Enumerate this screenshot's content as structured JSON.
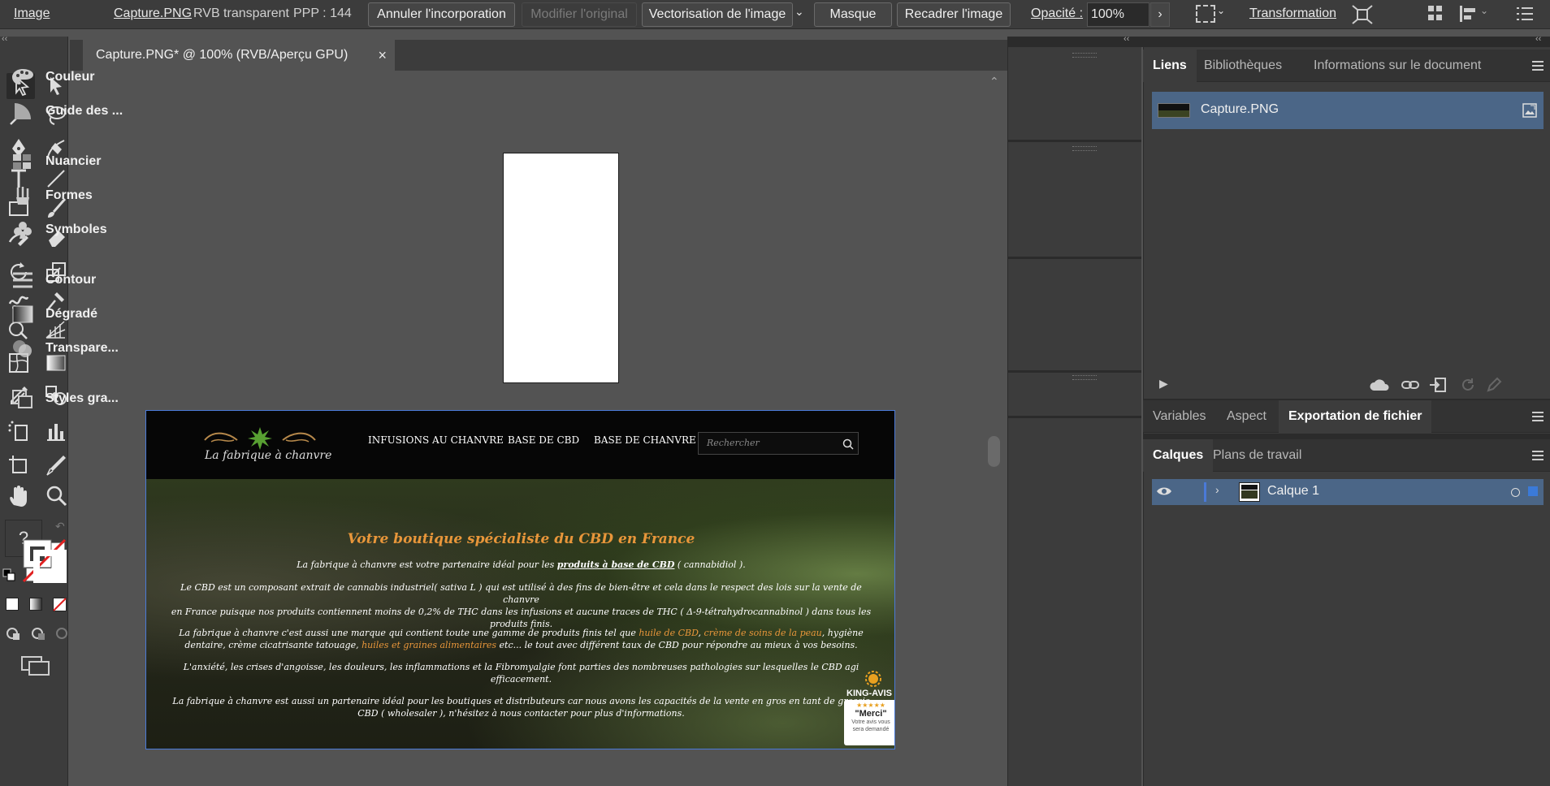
{
  "control_bar": {
    "image_label": "Image",
    "filename": "Capture.PNG",
    "color_mode": "RVB transparent",
    "ppp": "PPP : 144",
    "buttons": {
      "unembed": "Annuler l'incorporation",
      "edit_original": "Modifier l'original",
      "image_trace": "Vectorisation de l'image",
      "mask": "Masque",
      "crop": "Recadrer l'image"
    },
    "opacity_label": "Opacité :",
    "opacity_value": "100%",
    "transform_label": "Transformation"
  },
  "document": {
    "tab_title": "Capture.PNG* @ 100% (RVB/Aperçu GPU)",
    "close_symbol": "×"
  },
  "toolbar": {
    "unknown_tool": "?"
  },
  "placed_image": {
    "logo_text": "La fabrique à chanvre",
    "nav": [
      "INFUSIONS AU CHANVRE",
      "BASE DE CBD",
      "BASE DE CHANVRE"
    ],
    "search_placeholder": "Rechercher",
    "heading": "Votre boutique spécialiste du CBD en France",
    "p1_a": "La fabrique à chanvre est votre partenaire idéal pour les ",
    "p1_link": "produits à base de CBD",
    "p1_b": " ( ",
    "p1_em": "cannabidiol",
    "p1_c": " ).",
    "p2_line1": "Le CBD est un composant extrait de cannabis industriel( sativa L ) qui est utilisé à des fins de bien-être et cela dans le respect des lois sur la vente de chanvre",
    "p2_line2": "en France puisque nos produits contiennent moins de 0,2% de THC dans les infusions et aucune traces de THC ( Δ-9-tétrahydrocannabinol ) dans tous les",
    "p2_line3": "produits finis.",
    "p3_line1_a": "La fabrique à chanvre c'est aussi une marque qui contient toute une gamme de produits finis tel que ",
    "p3_oil": "huile de CBD",
    "p3_sep": ", ",
    "p3_cream": "crème de soins de la peau",
    "p3_line1_b": ", hygiène",
    "p3_line2_a": "dentaire, crème cicatrisante tatouage, ",
    "p3_seeds": "huiles et graines alimentaires",
    "p3_line2_b": " etc... le tout avec différent taux de CBD pour répondre au mieux à vos besoins.",
    "p4_line1": "L'anxiété, les crises d'angoisse, les douleurs, les inflammations et la Fibromyalgie font parties des nombreuses pathologies sur lesquelles le CBD agi",
    "p4_line2": "efficacement.",
    "p5_line1": "La fabrique à chanvre est aussi un partenaire idéal pour les boutiques et distributeurs car nous avons les capacités de la vente en gros en tant de grossis",
    "p5_line2": "CBD ( wholesaler ), n'hésitez à nous contacter pour plus d'informations.",
    "badge_title": "KING-AVIS",
    "badge_stars": "★★★★★",
    "badge_merci": "\"Merci\"",
    "badge_sub1": "Votre avis vous",
    "badge_sub2": "sera demandé"
  },
  "mid_panel": {
    "items": [
      "Couleur",
      "Guide des ...",
      "Nuancier",
      "Formes",
      "Symboles",
      "Contour",
      "Dégradé",
      "Transpare...",
      "Styles gra..."
    ]
  },
  "links_panel": {
    "tabs": [
      "Liens",
      "Bibliothèques",
      "Informations sur le document"
    ],
    "file": "Capture.PNG"
  },
  "export_panel": {
    "tabs": [
      "Variables",
      "Aspect",
      "Exportation de fichier"
    ]
  },
  "layers_panel": {
    "tabs": [
      "Calques",
      "Plans de travail"
    ],
    "layer_name": "Calque 1"
  },
  "colors": {
    "selection": "#4b6687",
    "accent_orange": "#e8963a",
    "bbox_blue": "#4a7ad8"
  }
}
